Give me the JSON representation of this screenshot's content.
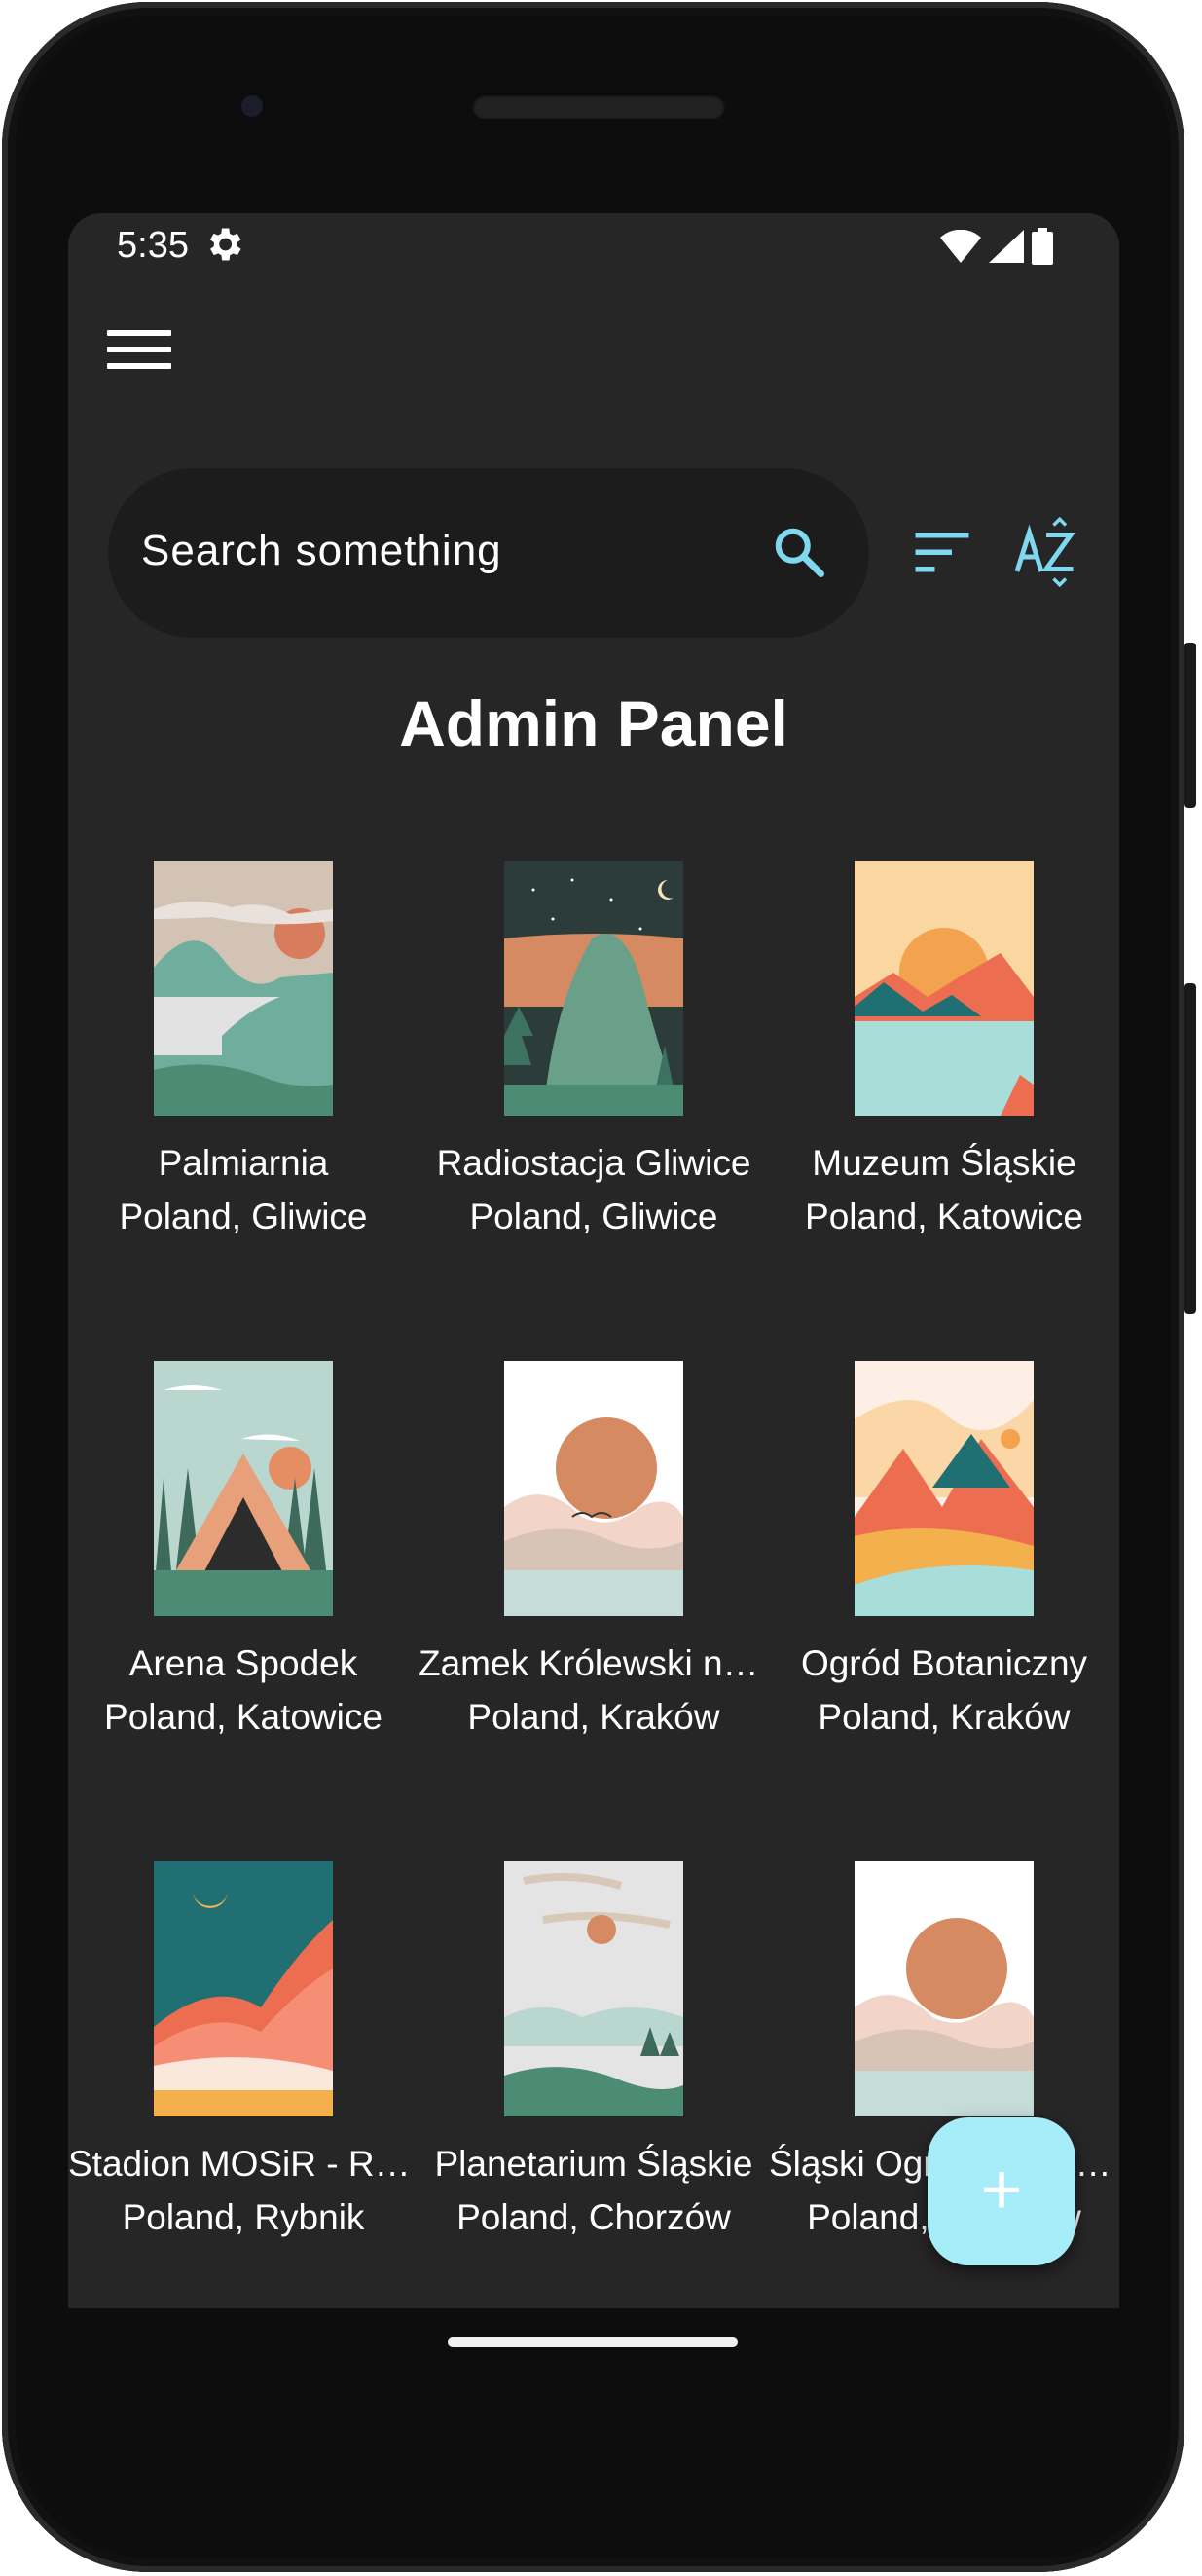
{
  "status_bar": {
    "time": "5:35",
    "icons": [
      "gear-icon",
      "wifi-icon",
      "signal-icon",
      "battery-icon"
    ]
  },
  "header": {
    "menu_icon": "hamburger-menu-icon"
  },
  "search": {
    "placeholder": "Search something",
    "icon": "search-icon"
  },
  "toolbar": {
    "filter_icon": "sort-icon",
    "az_icon": "sort-az-icon"
  },
  "page": {
    "title": "Admin Panel"
  },
  "items": [
    {
      "name": "Palmiarnia",
      "location": "Poland, Gliwice"
    },
    {
      "name": "Radiostacja Gliwice",
      "location": "Poland, Gliwice"
    },
    {
      "name": "Muzeum Śląskie",
      "location": "Poland, Katowice"
    },
    {
      "name": "Arena Spodek",
      "location": "Poland, Katowice"
    },
    {
      "name": "Zamek Królewski na Wawelu",
      "location": "Poland, Kraków"
    },
    {
      "name": "Ogród Botaniczny",
      "location": "Poland, Kraków"
    },
    {
      "name": "Stadion MOSiR - Rybnik",
      "location": "Poland, Rybnik"
    },
    {
      "name": "Planetarium Śląskie",
      "location": "Poland, Chorzów"
    },
    {
      "name": "Śląski Ogród Zoologiczny",
      "location": "Poland, Chorzów"
    }
  ],
  "fab": {
    "label": "+"
  },
  "colors": {
    "background": "#262626",
    "search_bg": "#1c1c1c",
    "accent": "#7fd8f0",
    "fab": "#a6ecf9"
  }
}
